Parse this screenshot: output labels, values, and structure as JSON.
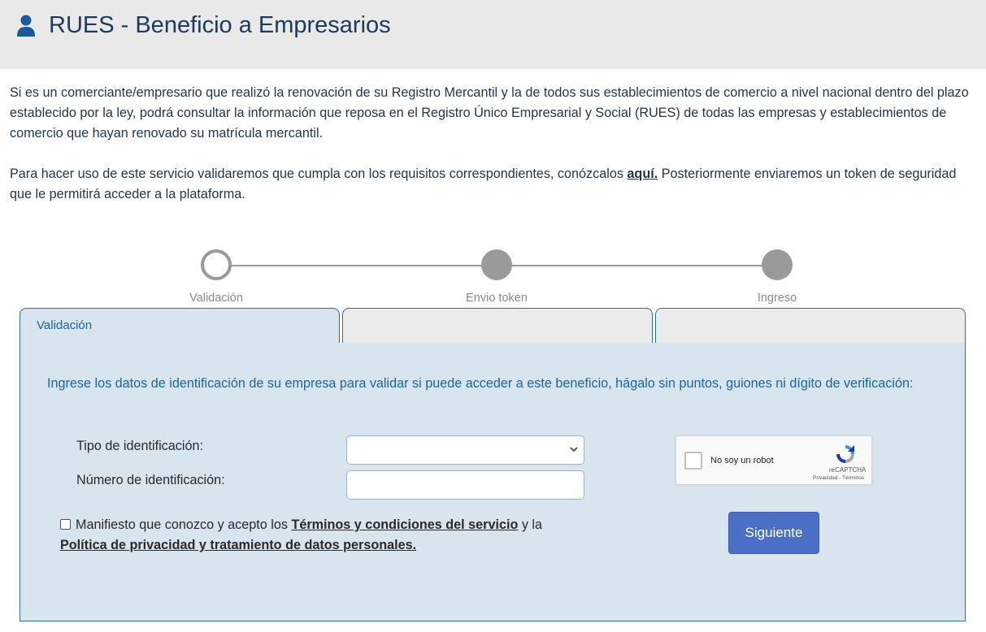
{
  "header": {
    "title": "RUES - Beneficio a Empresarios",
    "icon": "user-icon"
  },
  "intro": {
    "paragraph1": "Si es un comerciante/empresario que realizó la renovación de su Registro Mercantil y la de todos sus establecimientos de comercio a nivel nacional dentro del plazo establecido por la ley, podrá consultar la información que reposa en el Registro Único Empresarial y Social (RUES) de todas las empresas y establecimientos de comercio que hayan renovado su matrícula mercantil.",
    "paragraph2_before": "Para hacer uso de este servicio validaremos que cumpla con los requisitos correspondientes, conózcalos ",
    "paragraph2_link": "aquí.",
    "paragraph2_after": " Posteriormente enviaremos un token de seguridad que le permitirá acceder a la plataforma."
  },
  "stepper": {
    "steps": [
      {
        "label": "Validación",
        "state": "active"
      },
      {
        "label": "Envio token",
        "state": "pending"
      },
      {
        "label": "Ingreso",
        "state": "pending"
      }
    ]
  },
  "tabs": [
    {
      "label": "Validación",
      "active": true
    },
    {
      "label": "",
      "active": false
    },
    {
      "label": "",
      "active": false
    }
  ],
  "form": {
    "instructions": "Ingrese los datos de identificación de su empresa para validar si puede acceder a este beneficio, hágalo sin puntos, guiones ni dígito de verificación:",
    "id_type_label": "Tipo de identificación:",
    "id_type_value": "",
    "id_number_label": "Número de identificación:",
    "id_number_value": "",
    "terms_before": "Manifiesto que conozco y acepto los ",
    "terms_link": "Términos y condiciones del servicio",
    "terms_middle": " y la ",
    "privacy_link": "Política de privacidad y tratamiento de datos personales.",
    "terms_checked": false,
    "next_label": "Siguiente"
  },
  "recaptcha": {
    "label": "No soy un robot",
    "brand": "reCAPTCHA",
    "privacy": "Privacidad",
    "separator": " - ",
    "terms": "Términos"
  },
  "colors": {
    "header_bg": "#e9e9e9",
    "title": "#1b3a5c",
    "accent_blue": "#1a64a0",
    "panel_bg": "#d8e4ee",
    "button_bg": "#4a6fc4",
    "stepper_gray": "#9a9a9a"
  }
}
